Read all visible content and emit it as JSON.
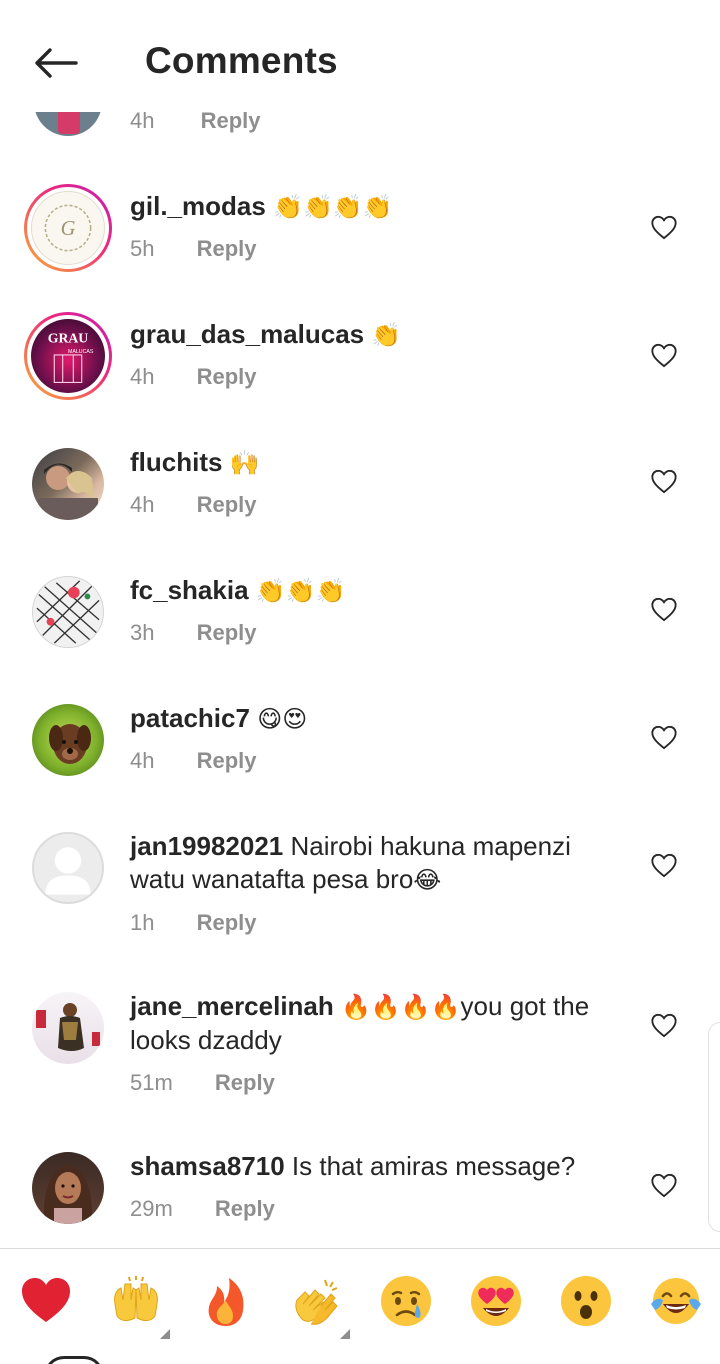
{
  "header": {
    "title": "Comments",
    "back_icon": "arrow-left-icon"
  },
  "partial_comment": {
    "time": "4h",
    "reply_label": "Reply"
  },
  "comments": [
    {
      "username": "gil._modas",
      "text": "",
      "emoji": "👏👏👏👏",
      "time": "5h",
      "reply_label": "Reply",
      "avatar": "gil-modas-logo-avatar",
      "story_ring": true
    },
    {
      "username": "grau_das_malucas",
      "text": "",
      "emoji": "👏",
      "time": "4h",
      "reply_label": "Reply",
      "avatar": "grau-das-malucas-logo-avatar",
      "avatar_text_top": "GRAU",
      "avatar_text_bottom": "MALUCAS",
      "story_ring": true
    },
    {
      "username": "fluchits",
      "text": "",
      "emoji": "🙌",
      "time": "4h",
      "reply_label": "Reply",
      "avatar": "couple-photo-avatar",
      "story_ring": false
    },
    {
      "username": "fc_shakia",
      "text": "",
      "emoji": "👏👏👏",
      "time": "3h",
      "reply_label": "Reply",
      "avatar": "fabric-pattern-avatar",
      "story_ring": false
    },
    {
      "username": "patachic7",
      "text": "",
      "emoji": "😋😍",
      "time": "4h",
      "reply_label": "Reply",
      "avatar": "puppy-photo-avatar",
      "story_ring": false
    },
    {
      "username": "jan19982021",
      "text": "Nairobi hakuna mapenzi watu wanatafta pesa bro",
      "emoji": "😂",
      "time": "1h",
      "reply_label": "Reply",
      "avatar": "default-user-avatar",
      "story_ring": false
    },
    {
      "username": "jane_mercelinah",
      "text_prefix": "🔥🔥🔥🔥",
      "text": "you got the looks dzaddy",
      "emoji": "",
      "time": "51m",
      "reply_label": "Reply",
      "avatar": "woman-photo-avatar",
      "story_ring": false
    },
    {
      "username": "shamsa8710",
      "text": "Is that amiras message?",
      "emoji": "",
      "time": "29m",
      "reply_label": "Reply",
      "avatar": "woman-portrait-avatar",
      "story_ring": false
    }
  ],
  "quick_reactions": [
    {
      "name": "red-heart",
      "glyph": "❤️"
    },
    {
      "name": "raising-hands",
      "glyph": "🙌"
    },
    {
      "name": "fire",
      "glyph": "🔥"
    },
    {
      "name": "clapping-hands",
      "glyph": "👏"
    },
    {
      "name": "crying-face",
      "glyph": "😢"
    },
    {
      "name": "heart-eyes",
      "glyph": "😍"
    },
    {
      "name": "surprised-face",
      "glyph": "😮"
    },
    {
      "name": "tears-of-joy",
      "glyph": "😂"
    }
  ],
  "colors": {
    "text": "#262626",
    "muted": "#8e8e8e",
    "divider": "#dbdbdb",
    "ring_start": "#f9b236",
    "ring_end": "#c21bb5"
  }
}
